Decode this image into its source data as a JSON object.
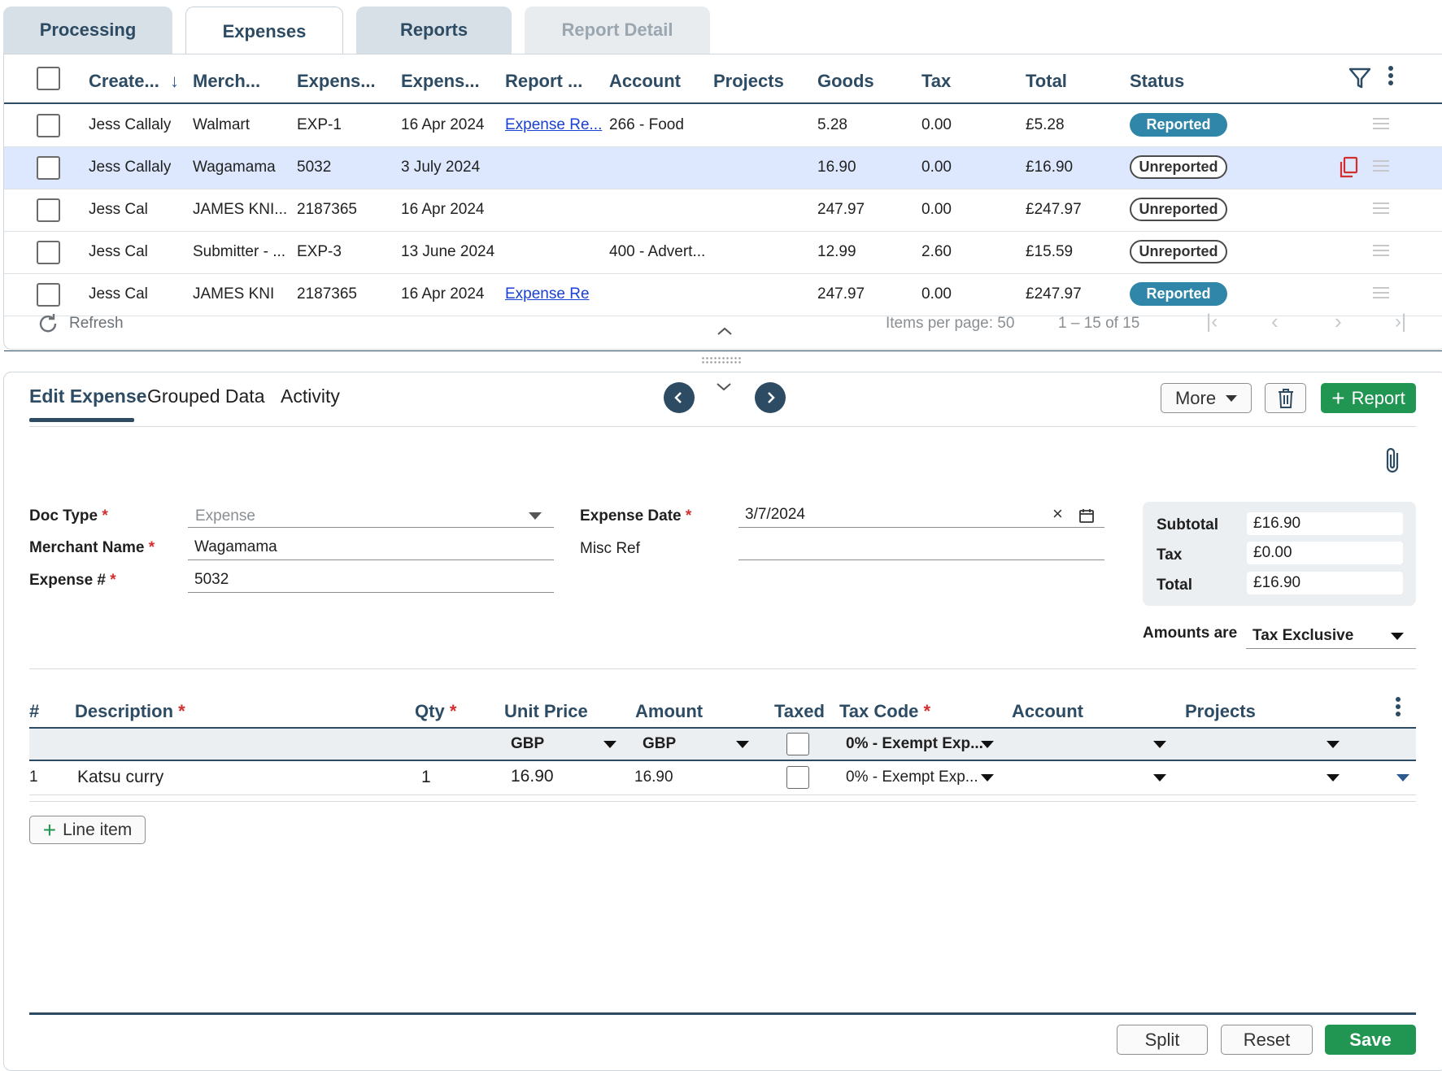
{
  "tabs": [
    {
      "label": "Processing"
    },
    {
      "label": "Expenses"
    },
    {
      "label": "Reports"
    },
    {
      "label": "Report Detail"
    }
  ],
  "grid": {
    "columns": [
      "Create...",
      "Merch...",
      "Expens...",
      "Expens...",
      "Report ...",
      "Account",
      "Projects",
      "Goods",
      "Tax",
      "Total",
      "Status"
    ],
    "rows": [
      {
        "created": "Jess Callaly",
        "merchant": "Walmart",
        "expense_no": "EXP-1",
        "date": "16 Apr 2024",
        "report": "Expense Re...",
        "account": "266 - Food",
        "projects": "",
        "goods": "5.28",
        "tax": "0.00",
        "total": "£5.28",
        "status": "Reported"
      },
      {
        "created": "Jess Callaly",
        "merchant": "Wagamama",
        "expense_no": "5032",
        "date": "3 July 2024",
        "report": "",
        "account": "",
        "projects": "",
        "goods": "16.90",
        "tax": "0.00",
        "total": "£16.90",
        "status": "Unreported"
      },
      {
        "created": "Jess Cal",
        "merchant": "JAMES KNI...",
        "expense_no": "2187365",
        "date": "16 Apr 2024",
        "report": "",
        "account": "",
        "projects": "",
        "goods": "247.97",
        "tax": "0.00",
        "total": "£247.97",
        "status": "Unreported"
      },
      {
        "created": "Jess Cal",
        "merchant": "Submitter - ...",
        "expense_no": "EXP-3",
        "date": "13 June 2024",
        "report": "",
        "account": "400 - Advert...",
        "projects": "",
        "goods": "12.99",
        "tax": "2.60",
        "total": "£15.59",
        "status": "Unreported"
      },
      {
        "created": "Jess Cal",
        "merchant": "JAMES KNI",
        "expense_no": "2187365",
        "date": "16 Apr 2024",
        "report": "Expense Re",
        "account": "",
        "projects": "",
        "goods": "247.97",
        "tax": "0.00",
        "total": "£247.97",
        "status": "Reported"
      }
    ]
  },
  "footer": {
    "refresh_label": "Refresh",
    "items_per_page": "Items per page:  50",
    "range": "1 – 15 of 15"
  },
  "edit": {
    "tabs": [
      "Edit Expense",
      "Grouped Data",
      "Activity"
    ],
    "more_label": "More",
    "report_label": "Report",
    "fields": {
      "doc_type_label": "Doc Type",
      "doc_type_value": "Expense",
      "merchant_label": "Merchant Name",
      "merchant_value": "Wagamama",
      "expense_no_label": "Expense #",
      "expense_no_value": "5032",
      "expense_date_label": "Expense Date",
      "expense_date_value": "3/7/2024",
      "misc_ref_label": "Misc Ref",
      "misc_ref_value": ""
    },
    "totals": {
      "subtotal_label": "Subtotal",
      "subtotal": "£16.90",
      "tax_label": "Tax",
      "tax": "£0.00",
      "total_label": "Total",
      "total": "£16.90",
      "amounts_are_label": "Amounts are",
      "amounts_are_value": "Tax Exclusive"
    },
    "lines": {
      "headers": [
        "#",
        "Description",
        "Qty",
        "Unit Price",
        "Amount",
        "Taxed",
        "Tax Code",
        "Account",
        "Projects"
      ],
      "defaults": {
        "unit_currency": "GBP",
        "amount_currency": "GBP",
        "tax_code": "0% - Exempt Exp..."
      },
      "items": [
        {
          "num": "1",
          "description": "Katsu curry",
          "qty": "1",
          "unit_price": "16.90",
          "amount": "16.90",
          "tax_code": "0% - Exempt Exp..."
        }
      ],
      "add_label": "Line item"
    },
    "actions": {
      "split": "Split",
      "reset": "Reset",
      "save": "Save"
    }
  },
  "colors": {
    "brand": "#2d4b63",
    "green": "#219653",
    "reported": "#2f86a8",
    "required": "#d32f2f",
    "selected_row": "#dde8ff"
  }
}
